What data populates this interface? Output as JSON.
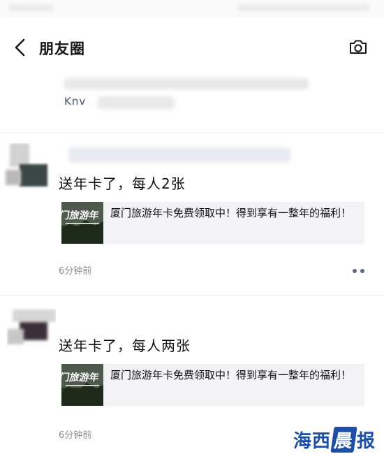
{
  "header": {
    "title": "朋友圈",
    "back_icon": "chevron-left-icon",
    "camera_icon": "camera-icon"
  },
  "hidden_post": {
    "partial_text": "Knv"
  },
  "posts": [
    {
      "text": "送年卡了，每人2张",
      "link_card": {
        "title": "厦门旅游年卡免费领取中！得到享有一整年的福利！",
        "thumb_caption": "门旅游年"
      },
      "time": "6分钟前"
    },
    {
      "text": "送年卡了，每人两张",
      "link_card": {
        "title": "厦门旅游年卡免费领取中！得到享有一整年的福利！",
        "thumb_caption": "门旅游年"
      },
      "time": "6分钟前"
    }
  ],
  "watermark": {
    "part1": "海西",
    "part2": "晨",
    "part3": "报"
  },
  "colors": {
    "link_blue": "#5c6b8a",
    "card_bg": "#f3f3f5",
    "watermark": "#1c4fa8"
  }
}
